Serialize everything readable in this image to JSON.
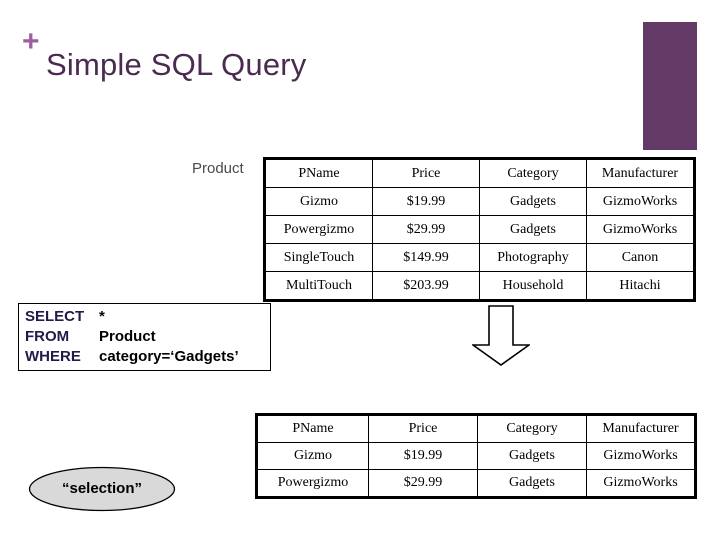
{
  "slide": {
    "bullet_glyph": "+",
    "title": "Simple SQL Query",
    "accent_color": "#633a66",
    "title_color": "#4a2a50",
    "bullet_color": "#9a5fa0"
  },
  "product_relation": {
    "label": "Product",
    "columns": [
      "PName",
      "Price",
      "Category",
      "Manufacturer"
    ],
    "rows": [
      [
        "Gizmo",
        "$19.99",
        "Gadgets",
        "GizmoWorks"
      ],
      [
        "Powergizmo",
        "$29.99",
        "Gadgets",
        "GizmoWorks"
      ],
      [
        "SingleTouch",
        "$149.99",
        "Photography",
        "Canon"
      ],
      [
        "MultiTouch",
        "$203.99",
        "Household",
        "Hitachi"
      ]
    ]
  },
  "sql_query": {
    "keyword_color": "#231a4a",
    "lines": [
      {
        "keyword": "SELECT",
        "value": "*"
      },
      {
        "keyword": "FROM",
        "value": "Product"
      },
      {
        "keyword": "WHERE",
        "value": "category=‘Gadgets’"
      }
    ]
  },
  "arrow": {
    "icon": "arrow-down-icon",
    "direction": "down"
  },
  "annotation": {
    "label": "“selection”",
    "fill_color": "#d9d9d9"
  },
  "result_relation": {
    "columns": [
      "PName",
      "Price",
      "Category",
      "Manufacturer"
    ],
    "rows": [
      [
        "Gizmo",
        "$19.99",
        "Gadgets",
        "GizmoWorks"
      ],
      [
        "Powergizmo",
        "$29.99",
        "Gadgets",
        "GizmoWorks"
      ]
    ]
  }
}
